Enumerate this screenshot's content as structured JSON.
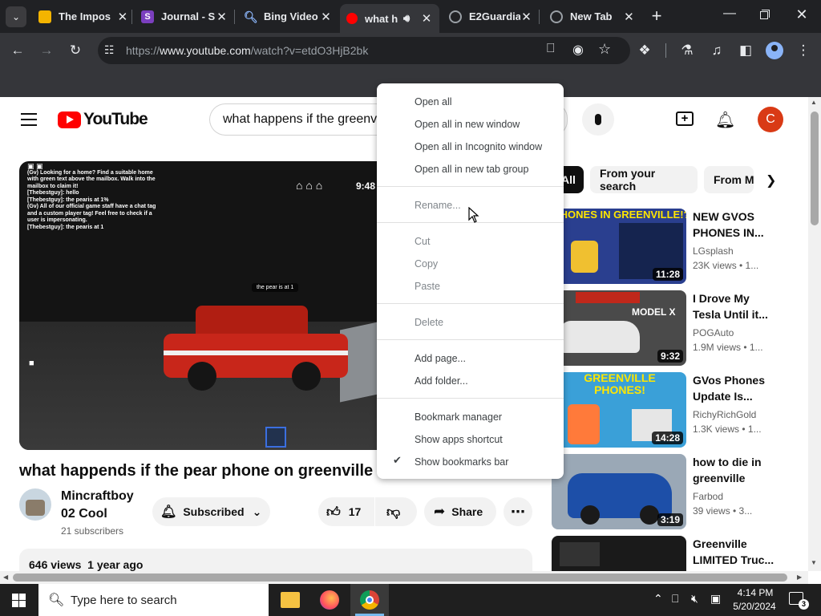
{
  "tabs": [
    {
      "label": "The Impos",
      "favicon_color": "#f4b400"
    },
    {
      "label": "Journal - S",
      "favicon_color": "#7b3fbf"
    },
    {
      "label": "Bing Video",
      "favicon_color": "#202124"
    },
    {
      "label": "what h",
      "favicon_color": "#ff0000"
    },
    {
      "label": "E2Guardia",
      "favicon_color": "#5f6368"
    },
    {
      "label": "New Tab",
      "favicon_color": "#5f6368"
    }
  ],
  "address": {
    "prefix": "https://",
    "domain": "www.youtube.com",
    "path": "/watch?v=etdO3HjB2bk"
  },
  "youtube": {
    "logo_text": "YouTube",
    "search_value": "what happens if the greenv",
    "avatar_letter": "C",
    "chips": [
      "All",
      "From your search",
      "From M"
    ],
    "video_title": "what happends if the pear phone on greenville bat",
    "channel_name_line1": "Mincraftboy",
    "channel_name_line2": "02 Cool",
    "subscribers": "21 subscribers",
    "subscribed_label": "Subscribed",
    "like_count": "17",
    "share_label": "Share",
    "views_line": "646 views  1 year ago",
    "overlay_time": "9:48",
    "chat_lines": [
      "(Gv) Looking for a home? Find a suitable home",
      "with green text above the mailbox. Walk into the",
      "mailbox to claim it!",
      "[Thebestguy]: hello",
      "[Thebestguy]: the pearis at 1%",
      "(Gv) All of our official game staff have a chat tag",
      "and a custom player tag! Feel free to check if a",
      "user is impersonating.",
      "[Thebestguy]: the pearis at 1"
    ],
    "speech_bubble": "the pear is at 1",
    "sidebar": [
      {
        "title_l1": "NEW GVOS",
        "title_l2": "PHONES IN...",
        "channel": "LGsplash",
        "meta": "23K views  • 1...",
        "duration": "11:28",
        "thumb_color": "#2a3f8f",
        "thumb_text": "PHONES IN GREENVILLE!?"
      },
      {
        "title_l1": "I Drove My",
        "title_l2": "Tesla Until it...",
        "channel": "POGAuto",
        "meta": "1.9M views  • 1...",
        "duration": "9:32",
        "thumb_color": "#4a4a4a",
        "thumb_text": "MODEL X"
      },
      {
        "title_l1": "GVos Phones",
        "title_l2": "Update Is...",
        "channel": "RichyRichGold",
        "meta": "1.3K views  • 1...",
        "duration": "14:28",
        "thumb_color": "#3aa0d8",
        "thumb_text": "GREENVILLE PHONES!"
      },
      {
        "title_l1": "how to die in",
        "title_l2": "greenville",
        "channel": "Farbod",
        "meta": "39 views  • 3...",
        "duration": "3:19",
        "thumb_color": "#1d4fa8",
        "thumb_text": ""
      },
      {
        "title_l1": "Greenville",
        "title_l2": "LIMITED Truc...",
        "channel": "",
        "meta": "",
        "duration": "",
        "thumb_color": "#1a1a1a",
        "thumb_text": ""
      }
    ]
  },
  "context_menu": {
    "groups": [
      [
        "Open all",
        "Open all in new window",
        "Open all in Incognito window",
        "Open all in new tab group"
      ],
      [
        "Rename..."
      ],
      [
        "Cut",
        "Copy",
        "Paste"
      ],
      [
        "Delete"
      ],
      [
        "Add page...",
        "Add folder..."
      ],
      [
        "Bookmark manager",
        "Show apps shortcut",
        "Show bookmarks bar"
      ]
    ],
    "checked_item": "Show bookmarks bar"
  },
  "taskbar": {
    "search_placeholder": "Type here to search",
    "time": "4:14 PM",
    "date": "5/20/2024",
    "notification_count": "3"
  },
  "colors": {
    "yt_red": "#ff0000",
    "chrome_dark": "#202124",
    "chrome_toolbar": "#35363a",
    "avatar": "#d93a15"
  }
}
